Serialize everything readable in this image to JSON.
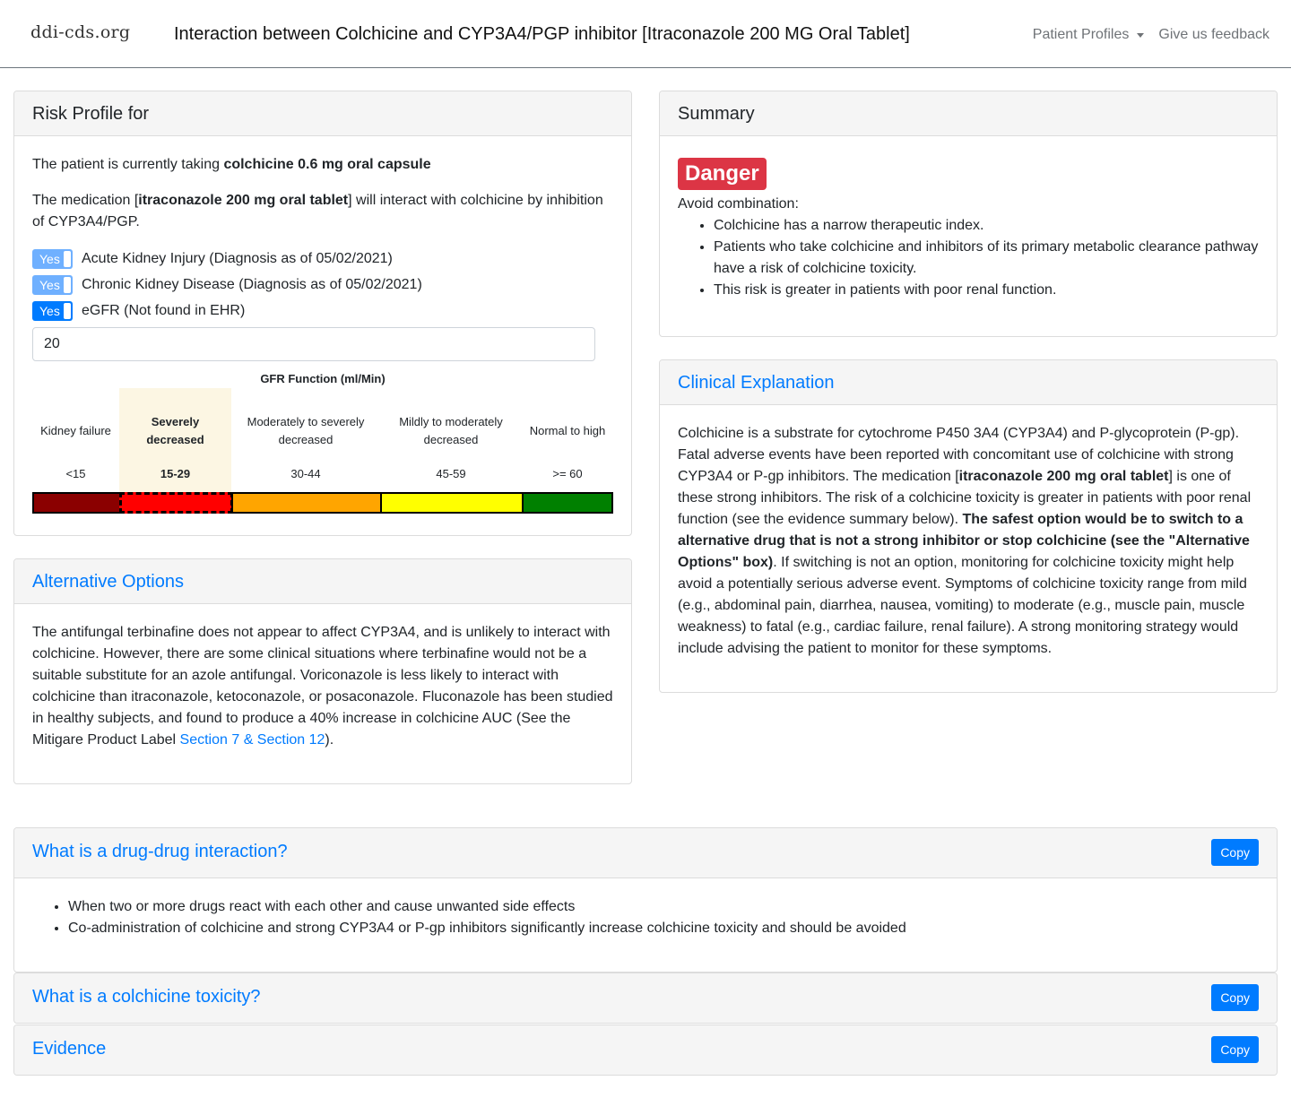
{
  "navbar": {
    "brand": "ddi-cds.org",
    "title": "Interaction between Colchicine and CYP3A4/PGP inhibitor [Itraconazole 200 MG Oral Tablet]",
    "patient_profiles_label": "Patient Profiles",
    "feedback_label": "Give us feedback"
  },
  "risk_profile": {
    "header": "Risk Profile for",
    "current_med_prefix": "The patient is currently taking ",
    "current_med": "colchicine 0.6 mg oral capsule",
    "interaction_prefix": "The medication [",
    "interaction_med": "itraconazole 200 mg oral tablet",
    "interaction_suffix": "] will interact with colchicine by inhibition of CYP3A4/PGP.",
    "toggles": [
      {
        "label": "Yes",
        "text": "Acute Kidney Injury (Diagnosis as of 05/02/2021)",
        "active": false
      },
      {
        "label": "Yes",
        "text": "Chronic Kidney Disease (Diagnosis as of 05/02/2021)",
        "active": false
      },
      {
        "label": "Yes",
        "text": "eGFR (Not found in EHR)",
        "active": true
      }
    ],
    "egfr_value": "20",
    "gfr": {
      "title": "GFR Function (ml/Min)",
      "selected_index": 1,
      "categories": [
        {
          "label": "Kidney failure",
          "range": "<15",
          "color": "#8b0000"
        },
        {
          "label": "Severely decreased",
          "range": "15-29",
          "color": "#ff0000"
        },
        {
          "label": "Moderately to severely decreased",
          "range": "30-44",
          "color": "#ffa500"
        },
        {
          "label": "Mildly to moderately decreased",
          "range": "45-59",
          "color": "#ffff00"
        },
        {
          "label": "Normal to high",
          "range": ">= 60",
          "color": "#008000"
        }
      ]
    }
  },
  "alternative_options": {
    "header": "Alternative Options",
    "text": "The antifungal terbinafine does not appear to affect CYP3A4, and is unlikely to interact with colchicine. However, there are some clinical situations where terbinafine would not be a suitable substitute for an azole antifungal. Voriconazole is less likely to interact with colchicine than itraconazole, ketoconazole, or posaconazole. Fluconazole has been studied in healthy subjects, and found to produce a 40% increase in colchicine AUC (See the Mitigare Product Label ",
    "link_text": "Section 7 & Section 12",
    "text_suffix": ")."
  },
  "summary": {
    "header": "Summary",
    "badge": "Danger",
    "lead": "Avoid combination:",
    "bullets": [
      "Colchicine has a narrow therapeutic index.",
      "Patients who take colchicine and inhibitors of its primary metabolic clearance pathway have a risk of colchicine toxicity.",
      "This risk is greater in patients with poor renal function."
    ]
  },
  "clinical_explanation": {
    "header": "Clinical Explanation",
    "part1": "Colchicine is a substrate for cytochrome P450 3A4 (CYP3A4) and P-glycoprotein (P-gp). Fatal adverse events have been reported with concomitant use of colchicine with strong CYP3A4 or P-gp inhibitors. The medication [",
    "med": "itraconazole 200 mg oral tablet",
    "part2": "] is one of these strong inhibitors. The risk of a colchicine toxicity is greater in patients with poor renal function (see the evidence summary below). ",
    "bold": "The safest option would be to switch to a alternative drug that is not a strong inhibitor or stop colchicine (see the \"Alternative Options\" box)",
    "part3": ". If switching is not an option, monitoring for colchicine toxicity might help avoid a potentially serious adverse event. Symptoms of colchicine toxicity range from mild (e.g., abdominal pain, diarrhea, nausea, vomiting) to moderate (e.g., muscle pain, muscle weakness) to fatal (e.g., cardiac failure, renal failure). A strong monitoring strategy would include advising the patient to monitor for these symptoms."
  },
  "accordion": [
    {
      "title": "What is a drug-drug interaction?",
      "copy_label": "Copy",
      "bullets": [
        "When two or more drugs react with each other and cause unwanted side effects",
        "Co-administration of colchicine and strong CYP3A4 or P-gp inhibitors significantly increase colchicine toxicity and should be avoided"
      ]
    },
    {
      "title": "What is a colchicine toxicity?",
      "copy_label": "Copy"
    },
    {
      "title": "Evidence",
      "copy_label": "Copy"
    }
  ]
}
